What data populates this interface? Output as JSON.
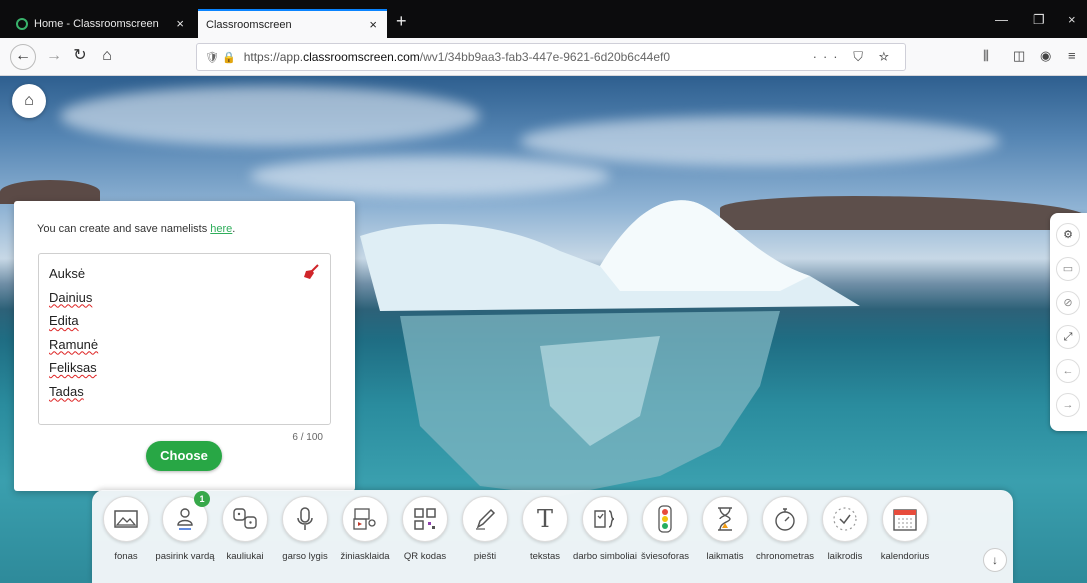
{
  "browser": {
    "tabs": [
      {
        "label": "Home - Classroomscreen",
        "close": "×"
      },
      {
        "label": "Classroomscreen",
        "close": "×"
      }
    ],
    "new_tab": "+",
    "window_controls": [
      "—",
      "❐",
      "×"
    ],
    "nav": {
      "back": "←",
      "forward": "→",
      "reload": "↻",
      "home": "⌂"
    },
    "url": {
      "prefix": "https://app.",
      "domain": "classroomscreen.com",
      "path": "/wv1/34bb9aa3-fab3-447e-9621-6d20b6c44ef0",
      "page_actions": "··· ⛉ ☆"
    },
    "right_icons": [
      "library-icon",
      "sidebar-icon",
      "account-icon",
      "menu-icon"
    ]
  },
  "page": {
    "home_icon": "home-icon",
    "namelist": {
      "info_text": "You can create and save namelists ",
      "info_link": "here",
      "info_end": ".",
      "names": [
        "Auksė",
        "Dainius",
        "Edita",
        "Ramunė",
        "Feliksas",
        "Tadas"
      ],
      "counter": "6 / 100",
      "choose_label": "Choose",
      "clear_icon": "broom-icon",
      "accent_color": "#28a745",
      "clear_color": "#d0252a"
    },
    "right_toolbar": [
      "settings-icon",
      "save-icon",
      "hide-icon",
      "fullscreen-icon",
      "undo-icon",
      "redo-icon"
    ],
    "dock": {
      "widgets": [
        {
          "label": "fonas",
          "icon": "image-icon"
        },
        {
          "label": "pasirink vardą",
          "icon": "random-name-icon",
          "badge": "1"
        },
        {
          "label": "kauliukai",
          "icon": "dice-icon"
        },
        {
          "label": "garso lygis",
          "icon": "microphone-icon"
        },
        {
          "label": "žiniasklaida",
          "icon": "media-icon"
        },
        {
          "label": "QR kodas",
          "icon": "qr-code-icon"
        },
        {
          "label": "piešti",
          "icon": "pencil-icon"
        },
        {
          "label": "tekstas",
          "icon": "text-icon"
        },
        {
          "label": "darbo simboliai",
          "icon": "work-symbols-icon"
        },
        {
          "label": "šviesoforas",
          "icon": "traffic-light-icon"
        },
        {
          "label": "laikmatis",
          "icon": "hourglass-icon"
        },
        {
          "label": "chronometras",
          "icon": "stopwatch-icon"
        },
        {
          "label": "laikrodis",
          "icon": "clock-icon"
        },
        {
          "label": "kalendorius",
          "icon": "calendar-icon"
        }
      ],
      "scroll_icon": "arrow-down-icon"
    }
  }
}
